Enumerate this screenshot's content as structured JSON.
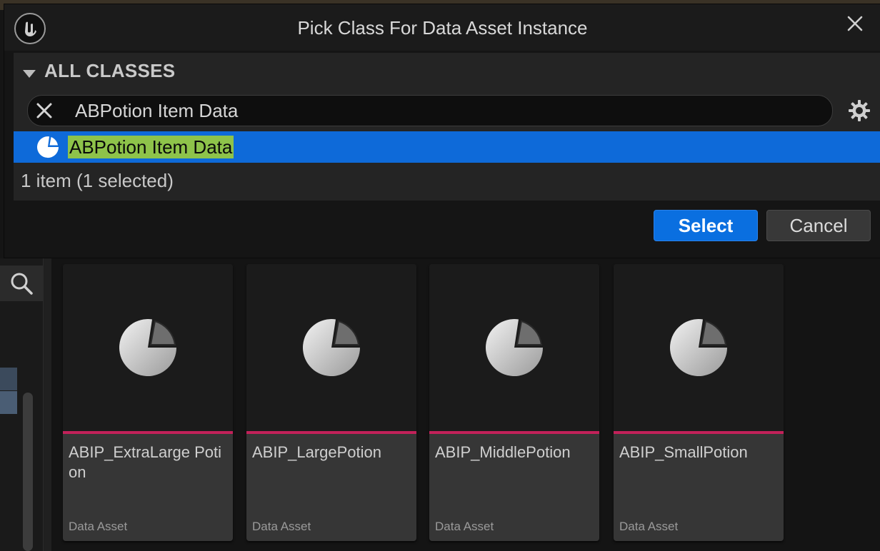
{
  "dialog": {
    "title": "Pick Class For Data Asset Instance",
    "section_label": "ALL CLASSES",
    "search": {
      "value": "ABPotion Item Data"
    },
    "results": [
      {
        "label": "ABPotion Item Data",
        "selected": true
      }
    ],
    "status": "1 item (1 selected)",
    "buttons": {
      "select": "Select",
      "cancel": "Cancel"
    }
  },
  "assets": [
    {
      "name": "ABIP_ExtraLarge Potion",
      "type": "Data Asset"
    },
    {
      "name": "ABIP_LargePotion",
      "type": "Data Asset"
    },
    {
      "name": "ABIP_MiddlePotion",
      "type": "Data Asset"
    },
    {
      "name": "ABIP_SmallPotion",
      "type": "Data Asset"
    }
  ],
  "icons": {
    "app_logo": "unreal-logo-icon",
    "close": "close-icon",
    "clear_search": "clear-search-icon",
    "settings": "gear-icon",
    "class_type": "data-asset-pie-icon",
    "search": "search-icon"
  },
  "colors": {
    "accent": "#0a6fe0",
    "highlight": "#8ec34a",
    "asset_stripe": "#c2215a"
  }
}
